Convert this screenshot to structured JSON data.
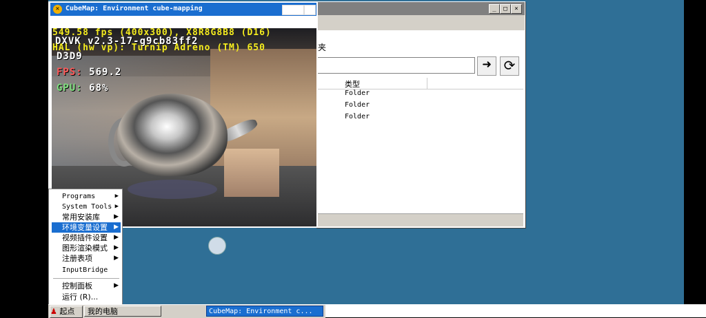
{
  "explorer": {
    "menu_text": "夹",
    "columns": [
      "类型"
    ],
    "rows": [
      "Folder",
      "Folder",
      "Folder"
    ],
    "go_icon": "arrow-right-icon",
    "refresh_icon": "refresh-icon"
  },
  "cubemap": {
    "title": "CubeMap: Environment cube-mapping",
    "overlay": {
      "fps_line": "549.58 fps (400x300), X8R8G8B8 (D16)",
      "dxvk": "DXVK v2.3-17-g9cb83ff2",
      "hal": "HAL (hw vp): Turnip Adreno (TM) 650",
      "api": "D3D9",
      "fps_label": "FPS:",
      "fps_value": "569.2",
      "gpu_label": "GPU:",
      "gpu_value": "68%"
    }
  },
  "start_menu": {
    "items": [
      {
        "label": "Programs",
        "submenu": true
      },
      {
        "label": "System Tools",
        "submenu": true
      },
      {
        "label": "常用安装库",
        "submenu": true
      },
      {
        "label": "环境变量设置",
        "submenu": true,
        "highlighted": true
      },
      {
        "label": "视频插件设置",
        "submenu": true
      },
      {
        "label": "图形渲染模式",
        "submenu": true
      },
      {
        "label": "注册表项",
        "submenu": true
      },
      {
        "label": "InputBridge",
        "submenu": false
      },
      {
        "label": "控制面板",
        "submenu": true
      },
      {
        "label": "运行 (R)...",
        "submenu": false
      }
    ]
  },
  "taskbar": {
    "start_label": "起点",
    "my_computer": "我的电脑",
    "task_cubemap": "CubeMap: Environment c..."
  },
  "colors": {
    "desktop": "#2f6f96",
    "title_active": "#1a6ed0",
    "overlay_yellow": "#f5ec1e"
  }
}
